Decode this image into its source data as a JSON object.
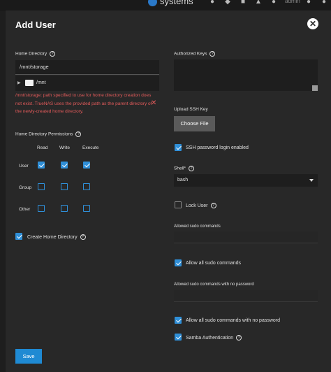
{
  "topbar": {
    "brand": "systems",
    "user_label": "admin"
  },
  "dialog": {
    "title": "Add User",
    "close_label": "✕",
    "save_label": "Save"
  },
  "left": {
    "home_directory_label": "Home Directory",
    "home_directory_value": "/mnt/storage",
    "tree_item": "/mnt",
    "error_text": "/mnt/storage: path specified to use for home directory creation does not exist. TrueNAS uses the provided path as the parent directory of the newly-created home directory.",
    "permissions_label": "Home Directory Permissions",
    "perm_columns": [
      "Read",
      "Write",
      "Execute"
    ],
    "perm_rows": [
      {
        "label": "User",
        "read": true,
        "write": true,
        "execute": true
      },
      {
        "label": "Group",
        "read": false,
        "write": false,
        "execute": false
      },
      {
        "label": "Other",
        "read": false,
        "write": false,
        "execute": false
      }
    ],
    "create_home_label": "Create Home Directory",
    "create_home_checked": true
  },
  "right": {
    "authorized_keys_label": "Authorized Keys",
    "upload_ssh_key_label": "Upload SSH Key",
    "choose_file_label": "Choose File",
    "ssh_password_login_label": "SSH password login enabled",
    "ssh_password_login_checked": true,
    "shell_label": "Shell",
    "shell_required_mark": "*",
    "shell_value": "bash",
    "lock_user_label": "Lock User",
    "lock_user_checked": false,
    "allowed_sudo_label": "Allowed sudo commands",
    "allow_all_sudo_label": "Allow all sudo commands",
    "allow_all_sudo_checked": true,
    "allowed_sudo_nopass_label": "Allowed sudo commands with no password",
    "allow_all_sudo_nopass_label": "Allow all sudo commands with no password",
    "allow_all_sudo_nopass_checked": true,
    "samba_auth_label": "Samba Authentication",
    "samba_auth_checked": true
  },
  "colors": {
    "accent": "#2f8fd8",
    "error": "#e15a5a",
    "panel": "#282828",
    "background": "#1e1e1e"
  }
}
